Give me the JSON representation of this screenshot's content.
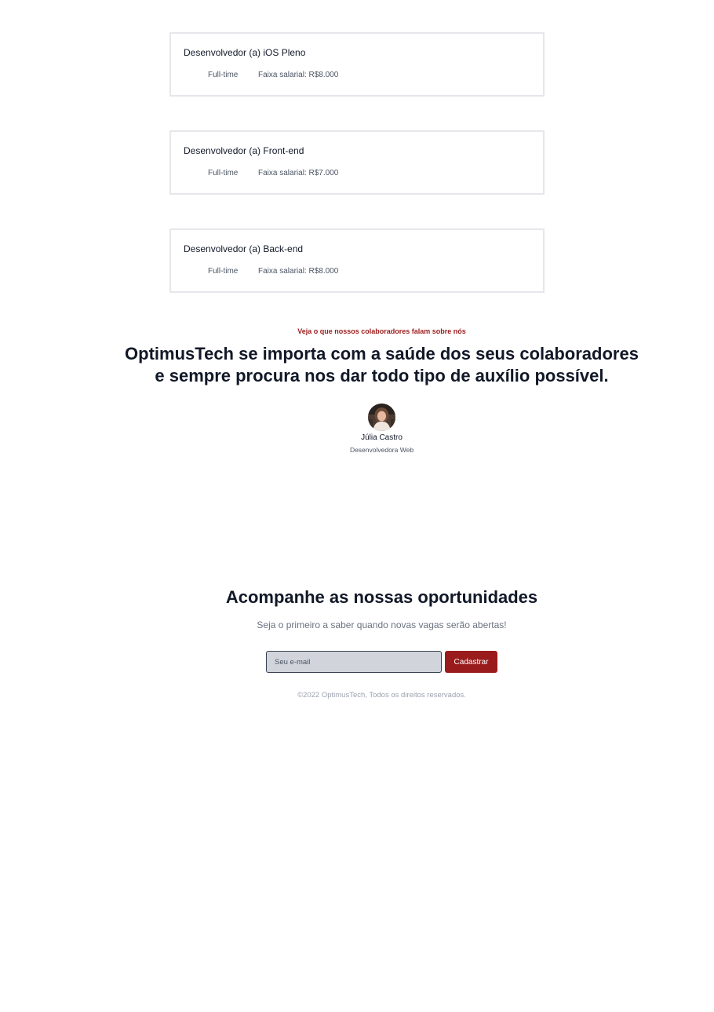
{
  "jobs": [
    {
      "title": "Desenvolvedor (a) iOS Pleno",
      "type": "Full-time",
      "salary": "Faixa salarial: R$8.000"
    },
    {
      "title": "Desenvolvedor (a) Front-end",
      "type": "Full-time",
      "salary": "Faixa salarial: R$7.000"
    },
    {
      "title": "Desenvolvedor (a) Back-end",
      "type": "Full-time",
      "salary": "Faixa salarial: R$8.000"
    }
  ],
  "testimonial": {
    "eyebrow": "Veja o que nossos colaboradores falam sobre nós",
    "quote_line1": "OptimusTech se importa com a saúde dos seus colaboradores",
    "quote_line2": "e sempre procura nos dar todo tipo de auxílio possível.",
    "author_name": "Júlia Castro",
    "author_role": "Desenvolvedora Web",
    "avatar_icon": "person-photo"
  },
  "newsletter": {
    "title": "Acompanhe as nossas oportunidades",
    "subtitle": "Seja o primeiro a saber quando novas vagas serão abertas!",
    "email_placeholder": "Seu e-mail",
    "submit_label": "Cadastrar"
  },
  "footer": {
    "copyright": "©2022 OptimusTech, Todos os direitos reservados."
  },
  "colors": {
    "accent": "#991b1b",
    "heading": "#111827",
    "muted": "#6b7280",
    "card_border": "#e5e7eb",
    "input_bg": "#d1d5db"
  }
}
